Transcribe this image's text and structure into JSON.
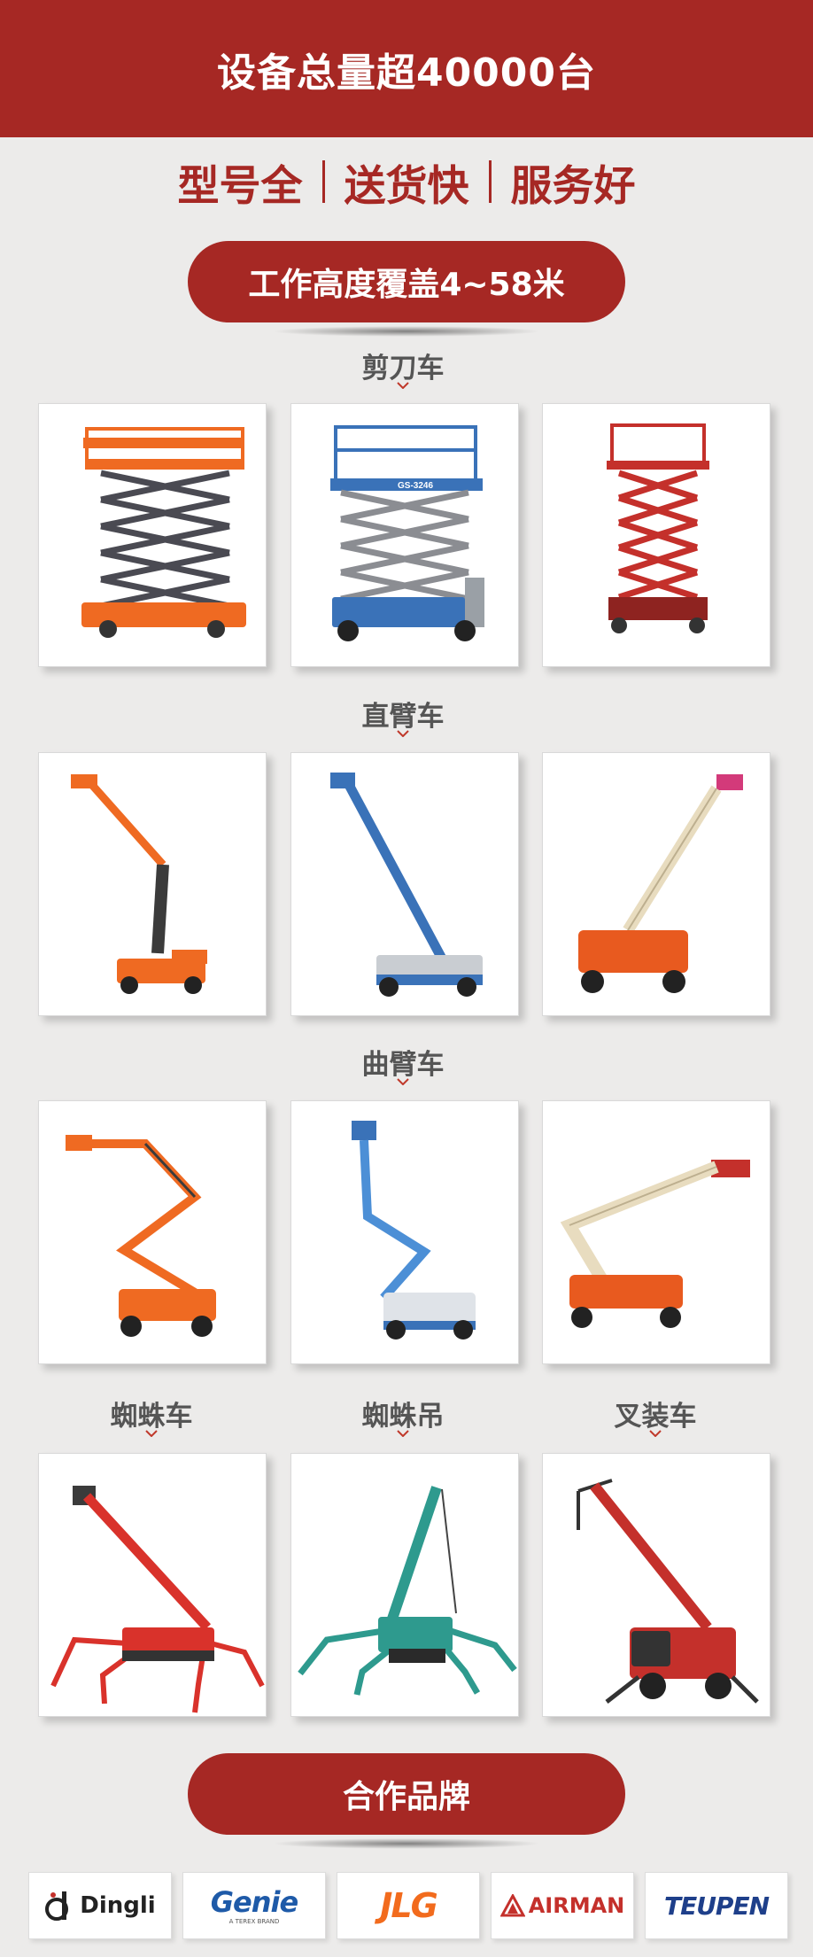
{
  "header": {
    "title": "设备总量超40000台"
  },
  "slogan": {
    "items": [
      "型号全",
      "送货快",
      "服务好"
    ]
  },
  "height_pill": {
    "label": "工作高度覆盖4~58米"
  },
  "categories": {
    "scissor": "剪刀车",
    "straight_boom": "直臂车",
    "curved_boom": "曲臂车",
    "spider": "蜘蛛车",
    "spider_crane": "蜘蛛吊",
    "telehandler": "叉装车"
  },
  "machines": {
    "scissor_blue_model": "GS-3246"
  },
  "partners_pill": {
    "label": "合作品牌"
  },
  "brands": {
    "dingli": "Dingli",
    "genie": "Genie",
    "genie_sub": "A TEREX BRAND",
    "jlg": "JLG",
    "airman": "AIRMAN",
    "teupen": "TEUPEN"
  },
  "colors": {
    "brand_red": "#a62824",
    "background": "#ecebea",
    "orange": "#ef6a22",
    "blue": "#3a72b8",
    "red_machine": "#c4302b",
    "teal": "#2e9a8e",
    "beige": "#e8dcbf"
  }
}
